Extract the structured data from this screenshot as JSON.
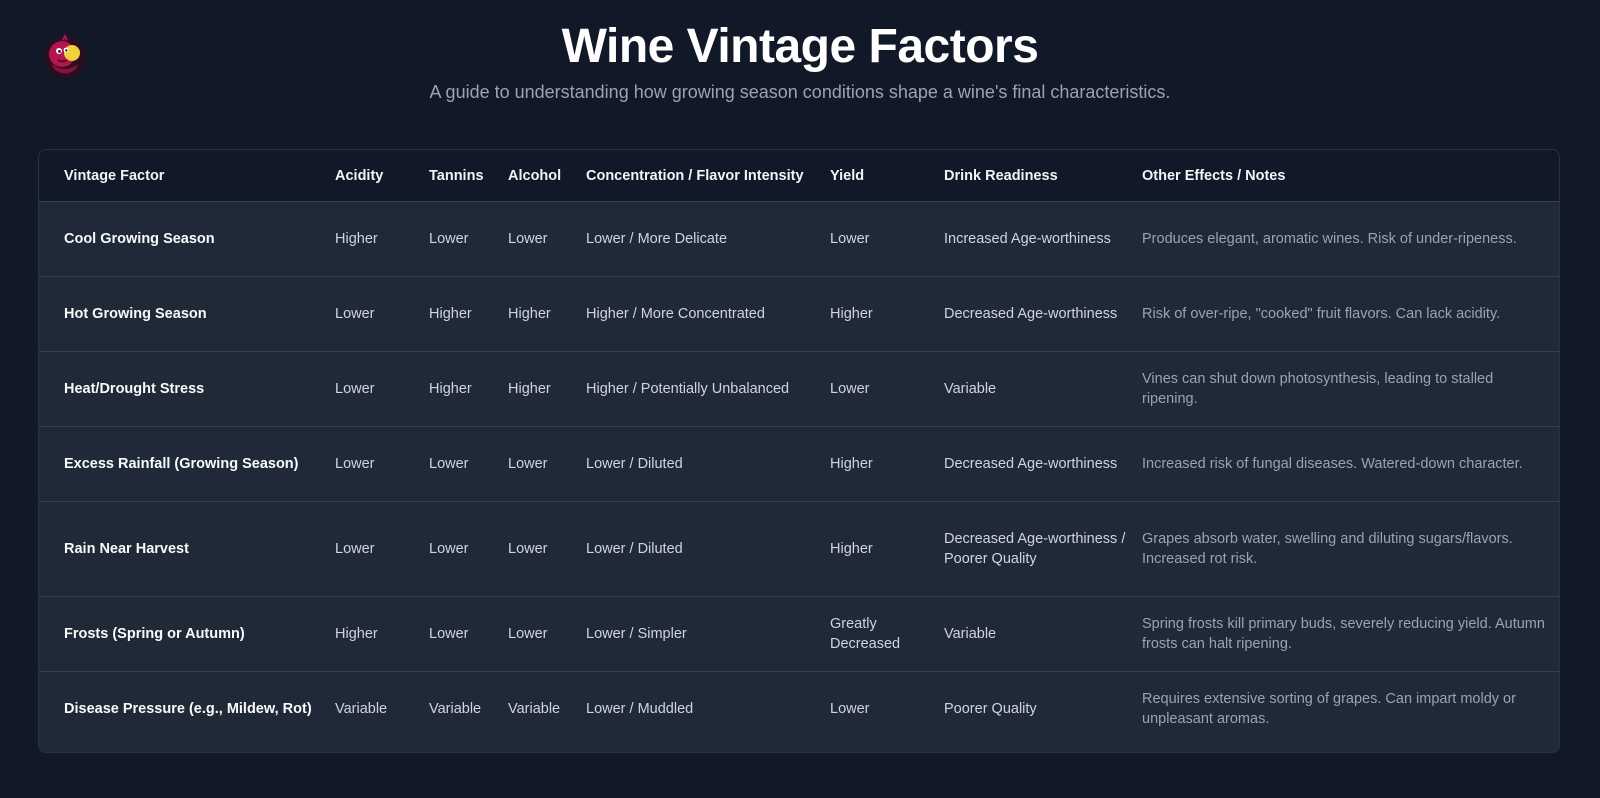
{
  "header": {
    "title": "Wine Vintage Factors",
    "subtitle": "A guide to understanding how growing season conditions shape a wine's final characteristics."
  },
  "logo": {
    "icon": "wine-mascot-logo-icon",
    "colors": {
      "primary": "#b5144f",
      "accent": "#f4d03f"
    }
  },
  "table": {
    "columns": [
      "Vintage Factor",
      "Acidity",
      "Tannins",
      "Alcohol",
      "Concentration / Flavor Intensity",
      "Yield",
      "Drink Readiness",
      "Other Effects / Notes"
    ],
    "rows": [
      [
        "Cool Growing Season",
        "Higher",
        "Lower",
        "Lower",
        "Lower / More Delicate",
        "Lower",
        "Increased Age-worthiness",
        "Produces elegant, aromatic wines. Risk of under-ripeness."
      ],
      [
        "Hot Growing Season",
        "Lower",
        "Higher",
        "Higher",
        "Higher / More Concentrated",
        "Higher",
        "Decreased Age-worthiness",
        "Risk of over-ripe, \"cooked\" fruit flavors. Can lack acidity."
      ],
      [
        "Heat/Drought Stress",
        "Lower",
        "Higher",
        "Higher",
        "Higher / Potentially Unbalanced",
        "Lower",
        "Variable",
        "Vines can shut down photosynthesis, leading to stalled ripening."
      ],
      [
        "Excess Rainfall (Growing Season)",
        "Lower",
        "Lower",
        "Lower",
        "Lower / Diluted",
        "Higher",
        "Decreased Age-worthiness",
        "Increased risk of fungal diseases. Watered-down character."
      ],
      [
        "Rain Near Harvest",
        "Lower",
        "Lower",
        "Lower",
        "Lower / Diluted",
        "Higher",
        "Decreased Age-worthiness / Poorer Quality",
        "Grapes absorb water, swelling and diluting sugars/flavors. Increased rot risk."
      ],
      [
        "Frosts (Spring or Autumn)",
        "Higher",
        "Lower",
        "Lower",
        "Lower / Simpler",
        "Greatly Decreased",
        "Variable",
        "Spring frosts kill primary buds, severely reducing yield. Autumn frosts can halt ripening."
      ],
      [
        "Disease Pressure (e.g., Mildew, Rot)",
        "Variable",
        "Variable",
        "Variable",
        "Lower / Muddled",
        "Lower",
        "Poorer Quality",
        "Requires extensive sorting of grapes. Can impart moldy or unpleasant aromas."
      ]
    ]
  },
  "colors": {
    "background": "#111827",
    "card": "#1f2937",
    "header_row": "#111827",
    "title": "#ffffff",
    "subtitle": "#9ca3af",
    "notes_text": "#9ca3af"
  }
}
